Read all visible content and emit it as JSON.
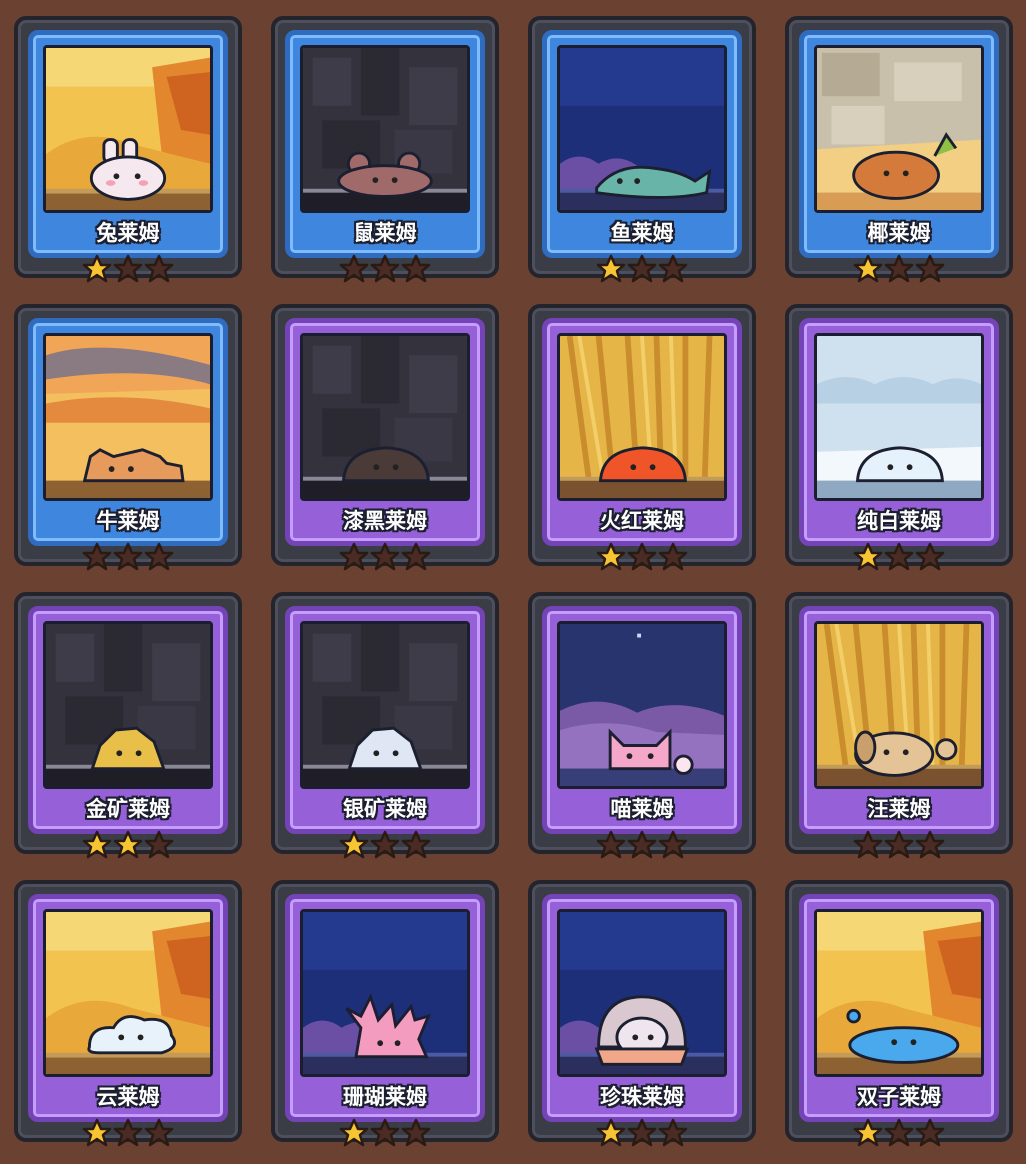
{
  "cards": [
    {
      "name": "兔莱姆",
      "stars": 1,
      "frame": "blue",
      "scene": "autumn",
      "creature": "rabbit",
      "color": "#f5e9ef"
    },
    {
      "name": "鼠莱姆",
      "stars": 0,
      "frame": "blue",
      "scene": "cave",
      "creature": "mouse",
      "color": "#a06a6a"
    },
    {
      "name": "鱼莱姆",
      "stars": 1,
      "frame": "blue",
      "scene": "ocean",
      "creature": "fish",
      "color": "#68b4a8"
    },
    {
      "name": "椰莱姆",
      "stars": 1,
      "frame": "blue",
      "scene": "rock",
      "creature": "coconut",
      "color": "#d47a3a"
    },
    {
      "name": "牛莱姆",
      "stars": 0,
      "frame": "blue",
      "scene": "sunset",
      "creature": "cow",
      "color": "#e69a5c"
    },
    {
      "name": "漆黑莱姆",
      "stars": 0,
      "frame": "purple",
      "scene": "cave",
      "creature": "blob",
      "color": "#4a3a38"
    },
    {
      "name": "火红莱姆",
      "stars": 1,
      "frame": "purple",
      "scene": "wheat",
      "creature": "blob",
      "color": "#f0552a"
    },
    {
      "name": "纯白莱姆",
      "stars": 1,
      "frame": "purple",
      "scene": "snow",
      "creature": "blob",
      "color": "#e6f2fb"
    },
    {
      "name": "金矿莱姆",
      "stars": 2,
      "frame": "purple",
      "scene": "cave",
      "creature": "rocky",
      "color": "#e8bf48"
    },
    {
      "name": "银矿莱姆",
      "stars": 1,
      "frame": "purple",
      "scene": "cave",
      "creature": "rocky",
      "color": "#dfe6f4"
    },
    {
      "name": "喵莱姆",
      "stars": 0,
      "frame": "purple",
      "scene": "night",
      "creature": "cat",
      "color": "#f5a7c9"
    },
    {
      "name": "汪莱姆",
      "stars": 0,
      "frame": "purple",
      "scene": "wheat",
      "creature": "dog",
      "color": "#e4c396"
    },
    {
      "name": "云莱姆",
      "stars": 1,
      "frame": "purple",
      "scene": "autumn",
      "creature": "cloud",
      "color": "#e8f2fa"
    },
    {
      "name": "珊瑚莱姆",
      "stars": 1,
      "frame": "purple",
      "scene": "ocean",
      "creature": "coral",
      "color": "#f49cc0"
    },
    {
      "name": "珍珠莱姆",
      "stars": 1,
      "frame": "purple",
      "scene": "ocean",
      "creature": "pearl",
      "color": "#efe5ee"
    },
    {
      "name": "双子莱姆",
      "stars": 1,
      "frame": "purple",
      "scene": "autumn",
      "creature": "twin",
      "color": "#4aa8ec"
    }
  ],
  "max_stars": 3,
  "colors": {
    "star_filled": "#f7c531",
    "star_empty": "#4a2c24",
    "background": "#6b4232"
  }
}
